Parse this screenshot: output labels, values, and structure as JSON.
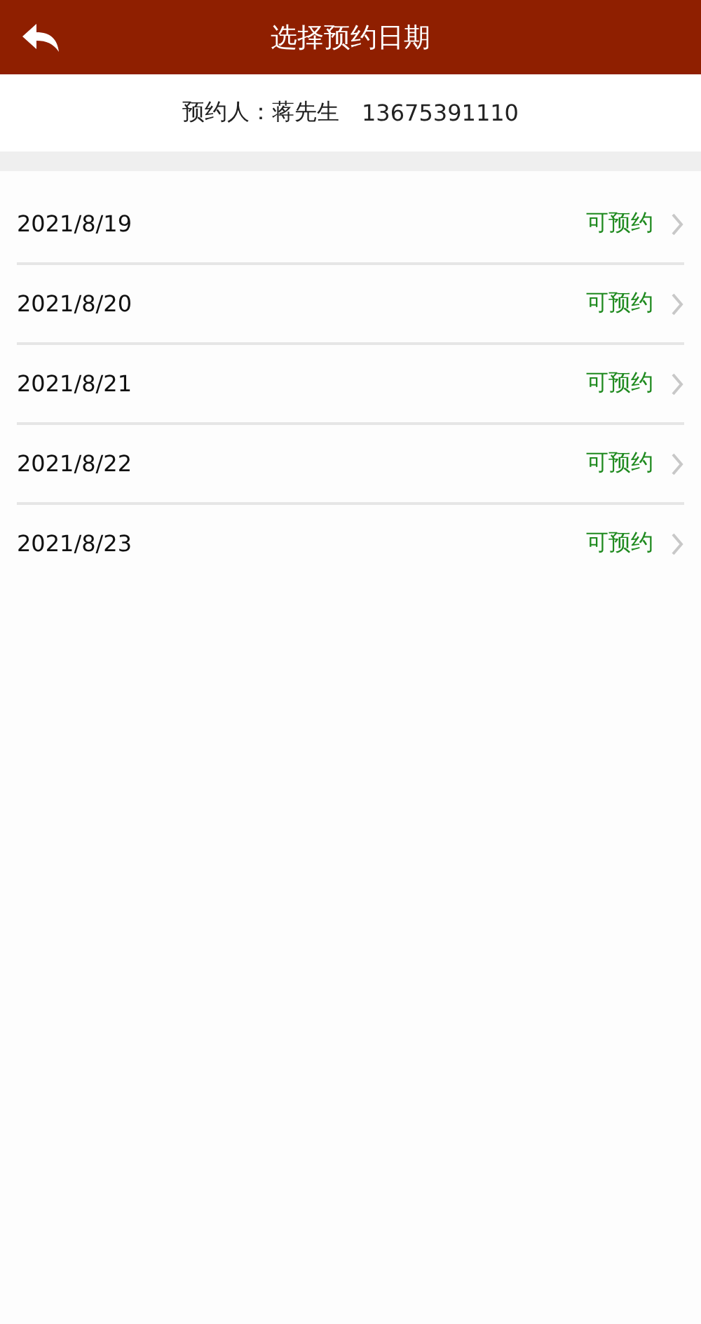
{
  "header": {
    "title": "选择预约日期"
  },
  "booker": {
    "label": "预约人：蒋先生",
    "phone": "13675391110"
  },
  "dates": [
    {
      "date": "2021/8/19",
      "status": "可预约",
      "available": true
    },
    {
      "date": "2021/8/20",
      "status": "可预约",
      "available": true
    },
    {
      "date": "2021/8/21",
      "status": "可预约",
      "available": true
    },
    {
      "date": "2021/8/22",
      "status": "可预约",
      "available": true
    },
    {
      "date": "2021/8/23",
      "status": "可预约",
      "available": true
    }
  ]
}
